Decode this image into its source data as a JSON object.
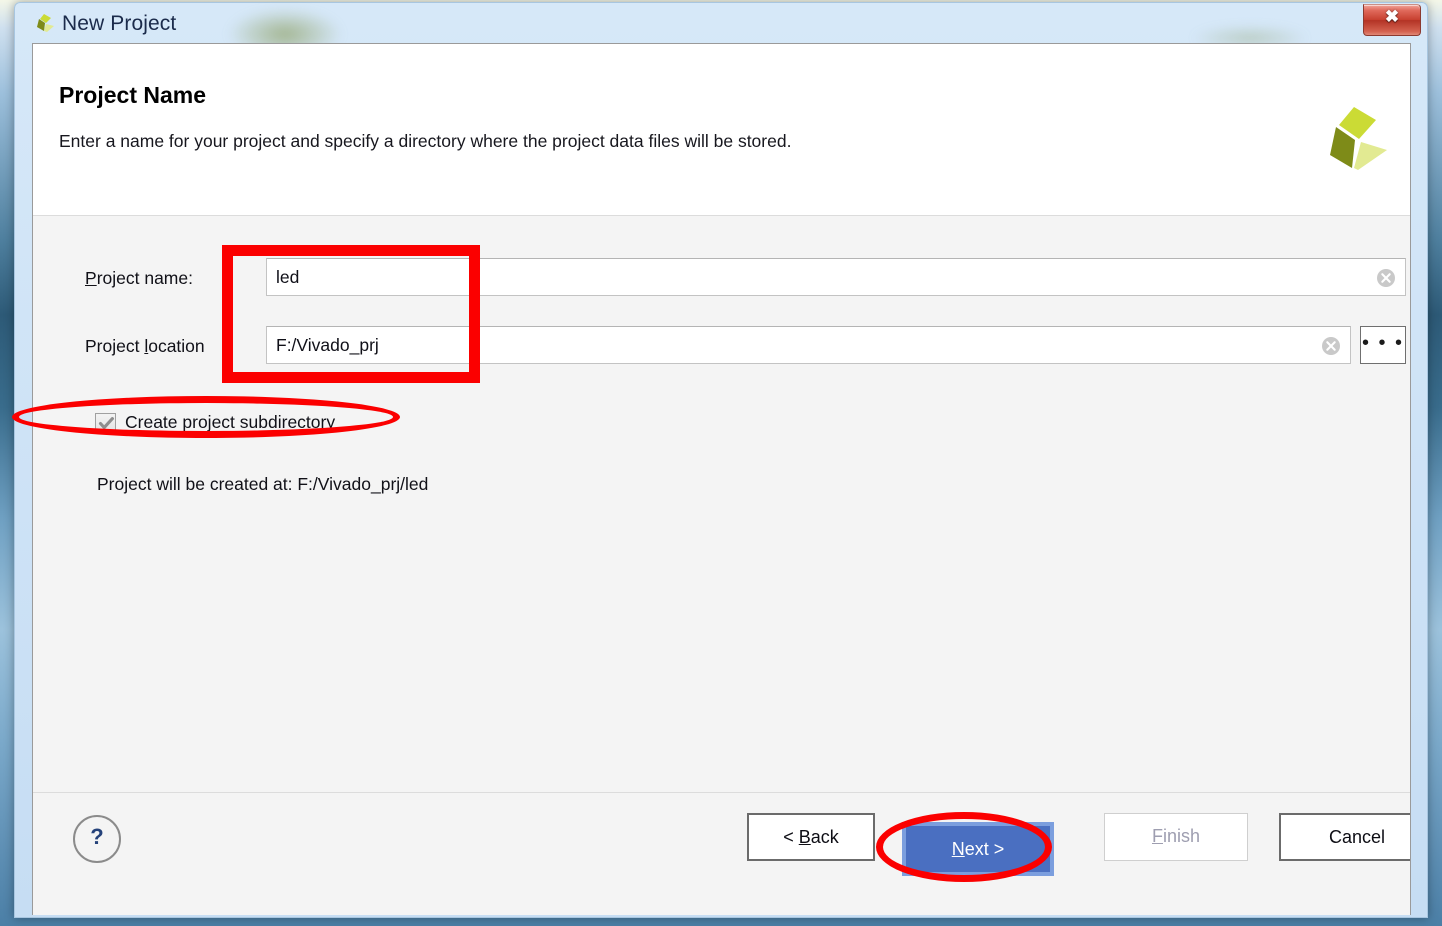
{
  "window": {
    "title": "New Project",
    "app_icon": "xilinx-logo-icon",
    "close_label": "✖"
  },
  "header": {
    "title": "Project Name",
    "subtitle": "Enter a name for your project and specify a directory where the project data files will be stored.",
    "logo": "xilinx-logo-icon"
  },
  "form": {
    "project_name": {
      "label_prefix": "",
      "label_mnemonic": "P",
      "label_suffix": "roject name:",
      "value": "led",
      "placeholder": "",
      "clear_icon": "clear-circle-x-icon"
    },
    "project_location": {
      "label_prefix": "Project ",
      "label_mnemonic": "l",
      "label_suffix": "ocation",
      "value": "F:/Vivado_prj",
      "placeholder": "",
      "clear_icon": "clear-circle-x-icon",
      "browse_label": "• • •"
    },
    "subdirectory": {
      "label": "Create project subdirectory",
      "checked": true
    },
    "created_at": "Project will be created at: F:/Vivado_prj/led"
  },
  "footer": {
    "help_label": "?",
    "back": {
      "prefix": "< ",
      "mnemonic": "B",
      "suffix": "ack"
    },
    "next": {
      "mnemonic": "N",
      "suffix": "ext >"
    },
    "finish": {
      "mnemonic": "F",
      "suffix": "inish"
    },
    "cancel": {
      "label": "Cancel"
    }
  },
  "annotations": {
    "rect_label": "highlight-project-fields",
    "ellipse_checkbox_label": "highlight-create-subdirectory",
    "ellipse_next_label": "highlight-next-button",
    "color": "#fb0000"
  },
  "colors": {
    "accent_blue": "#4a6fc1",
    "accent_blue_outer": "#7b9ede",
    "annotation_red": "#fb0000",
    "brand_green_dark": "#7e8b18",
    "brand_green_mid": "#cbdb35",
    "brand_green_light": "#e2ea92",
    "dialog_bg": "#f4f4f4",
    "header_bg": "#ffffff",
    "titlebar_bg": "#cde2f6"
  }
}
